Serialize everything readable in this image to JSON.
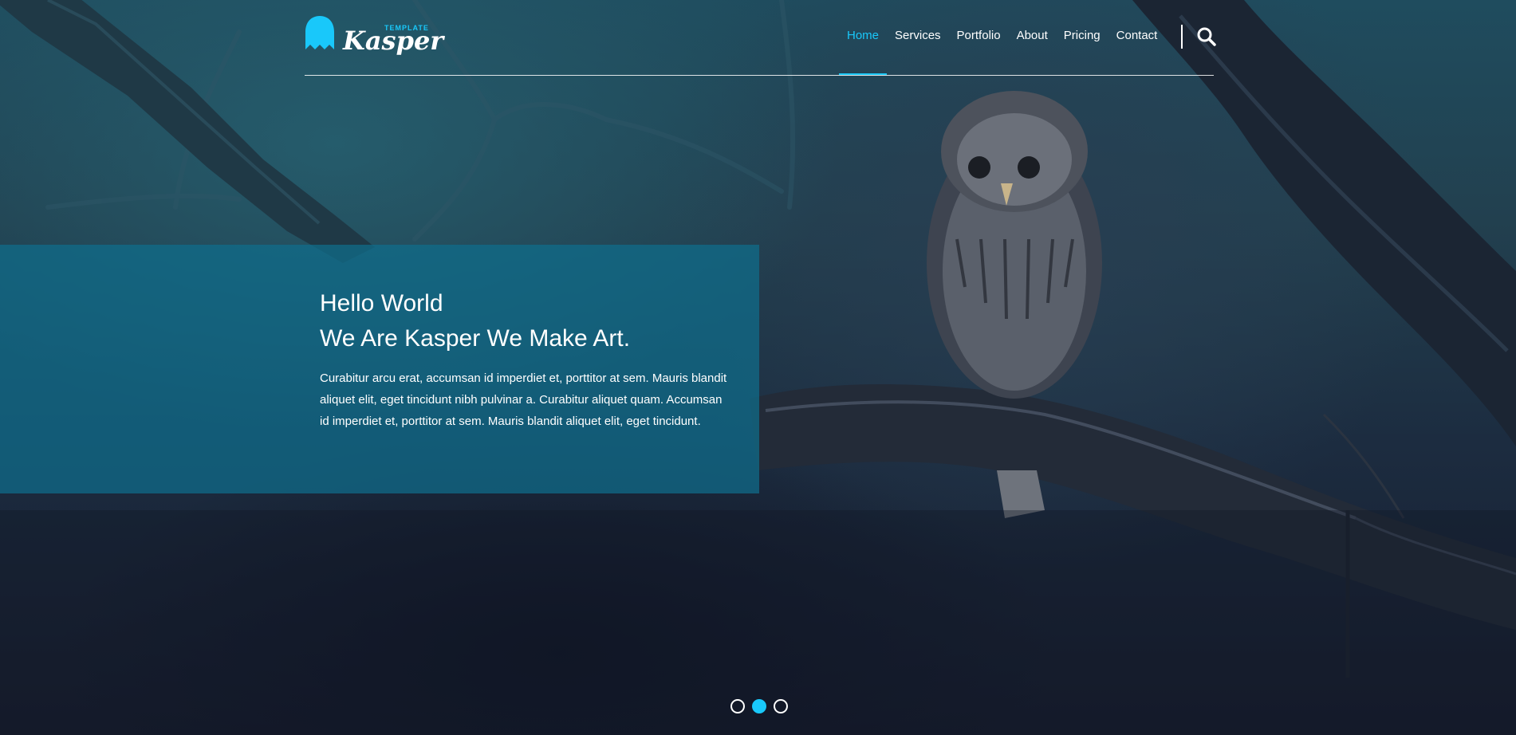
{
  "brand": {
    "name": "Kasper",
    "tag": "TEMPLATE",
    "logo_icon": "ghost-icon",
    "accent_color": "#19c8fa"
  },
  "nav": {
    "items": [
      {
        "label": "Home",
        "active": true
      },
      {
        "label": "Services",
        "active": false
      },
      {
        "label": "Portfolio",
        "active": false
      },
      {
        "label": "About",
        "active": false
      },
      {
        "label": "Pricing",
        "active": false
      },
      {
        "label": "Contact",
        "active": false
      }
    ],
    "search_icon": "search-icon"
  },
  "hero": {
    "heading_line1": "Hello World",
    "heading_line2": "We Are Kasper We Make Art.",
    "paragraph": "Curabitur arcu erat, accumsan id imperdiet et, porttitor at sem. Mauris blandit aliquet elit, eget tincidunt nibh pulvinar a. Curabitur aliquet quam. Accumsan id imperdiet et, porttitor at sem. Mauris blandit aliquet elit, eget tincidunt.",
    "panel_color": "#0f6e8c"
  },
  "slider": {
    "count": 3,
    "active_index": 1
  }
}
